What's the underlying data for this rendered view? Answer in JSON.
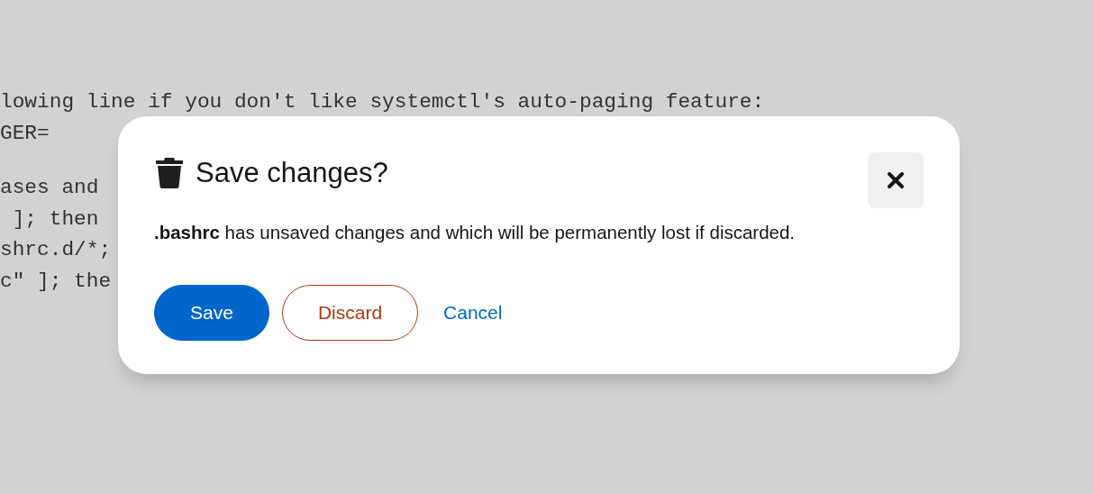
{
  "editor": {
    "lines": [
      "lowing line if you don't like systemctl's auto-paging feature:",
      "GER=",
      "ases and",
      " ]; then",
      "shrc.d/*;",
      "c\" ]; the"
    ]
  },
  "modal": {
    "title": "Save changes?",
    "body": "**.bashrc** has unsaved changes and which will be permanently lost if discarded.",
    "buttons": [
      {
        "label": "Save",
        "kind": "primary"
      },
      {
        "label": "Discard",
        "kind": "danger"
      },
      {
        "label": "Cancel",
        "kind": "link"
      }
    ]
  }
}
